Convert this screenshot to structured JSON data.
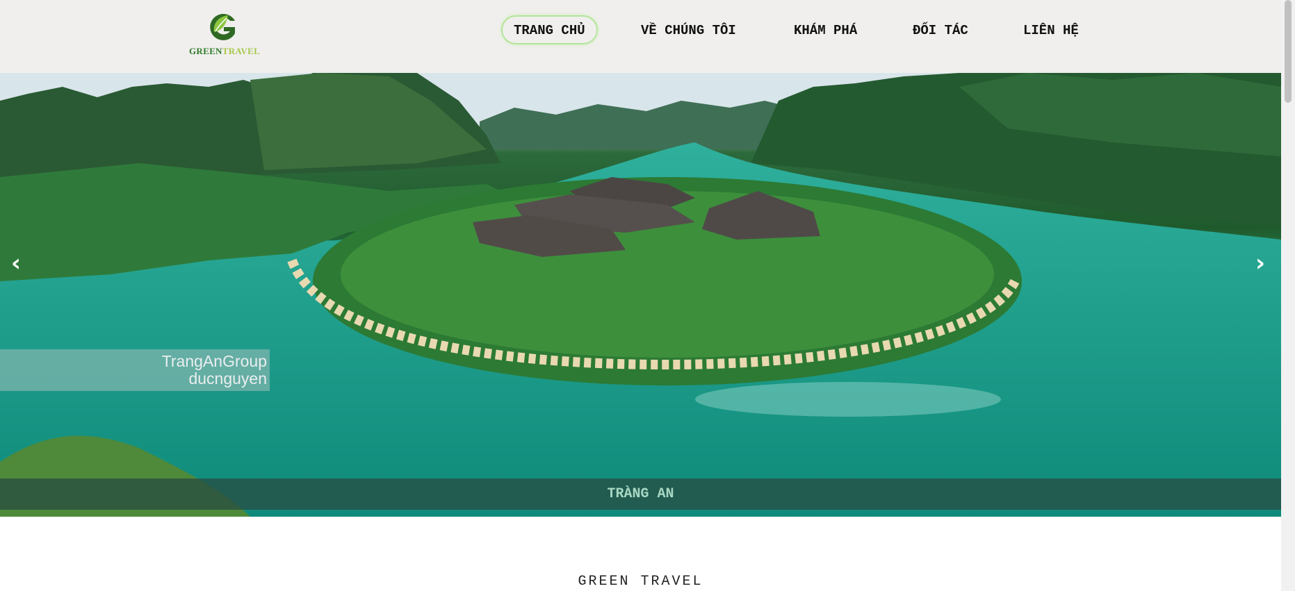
{
  "header": {
    "logo_icon": "green-leaf-g-icon",
    "logo_word_green": "GREEN",
    "logo_word_travel": "TRAVEL",
    "nav": [
      {
        "label": "TRANG CHỦ",
        "active": true
      },
      {
        "label": "VỀ CHÚNG TÔI",
        "active": false
      },
      {
        "label": "KHÁM PHÁ",
        "active": false
      },
      {
        "label": "ĐỐI TÁC",
        "active": false
      },
      {
        "label": "LIÊN HỆ",
        "active": false
      }
    ]
  },
  "hero": {
    "watermark_line1": "TrangAnGroup",
    "watermark_line2": "ducnguyen",
    "prev_icon": "‹",
    "next_icon": "›",
    "caption": "TRÀNG AN"
  },
  "section": {
    "title": "GREEN TRAVEL"
  },
  "colors": {
    "header_bg": "#f0efed",
    "active_border": "#b4e59a",
    "logo_green": "#2f7a2a",
    "logo_light": "#a8c84a",
    "caption_text": "#a8d8c4"
  }
}
